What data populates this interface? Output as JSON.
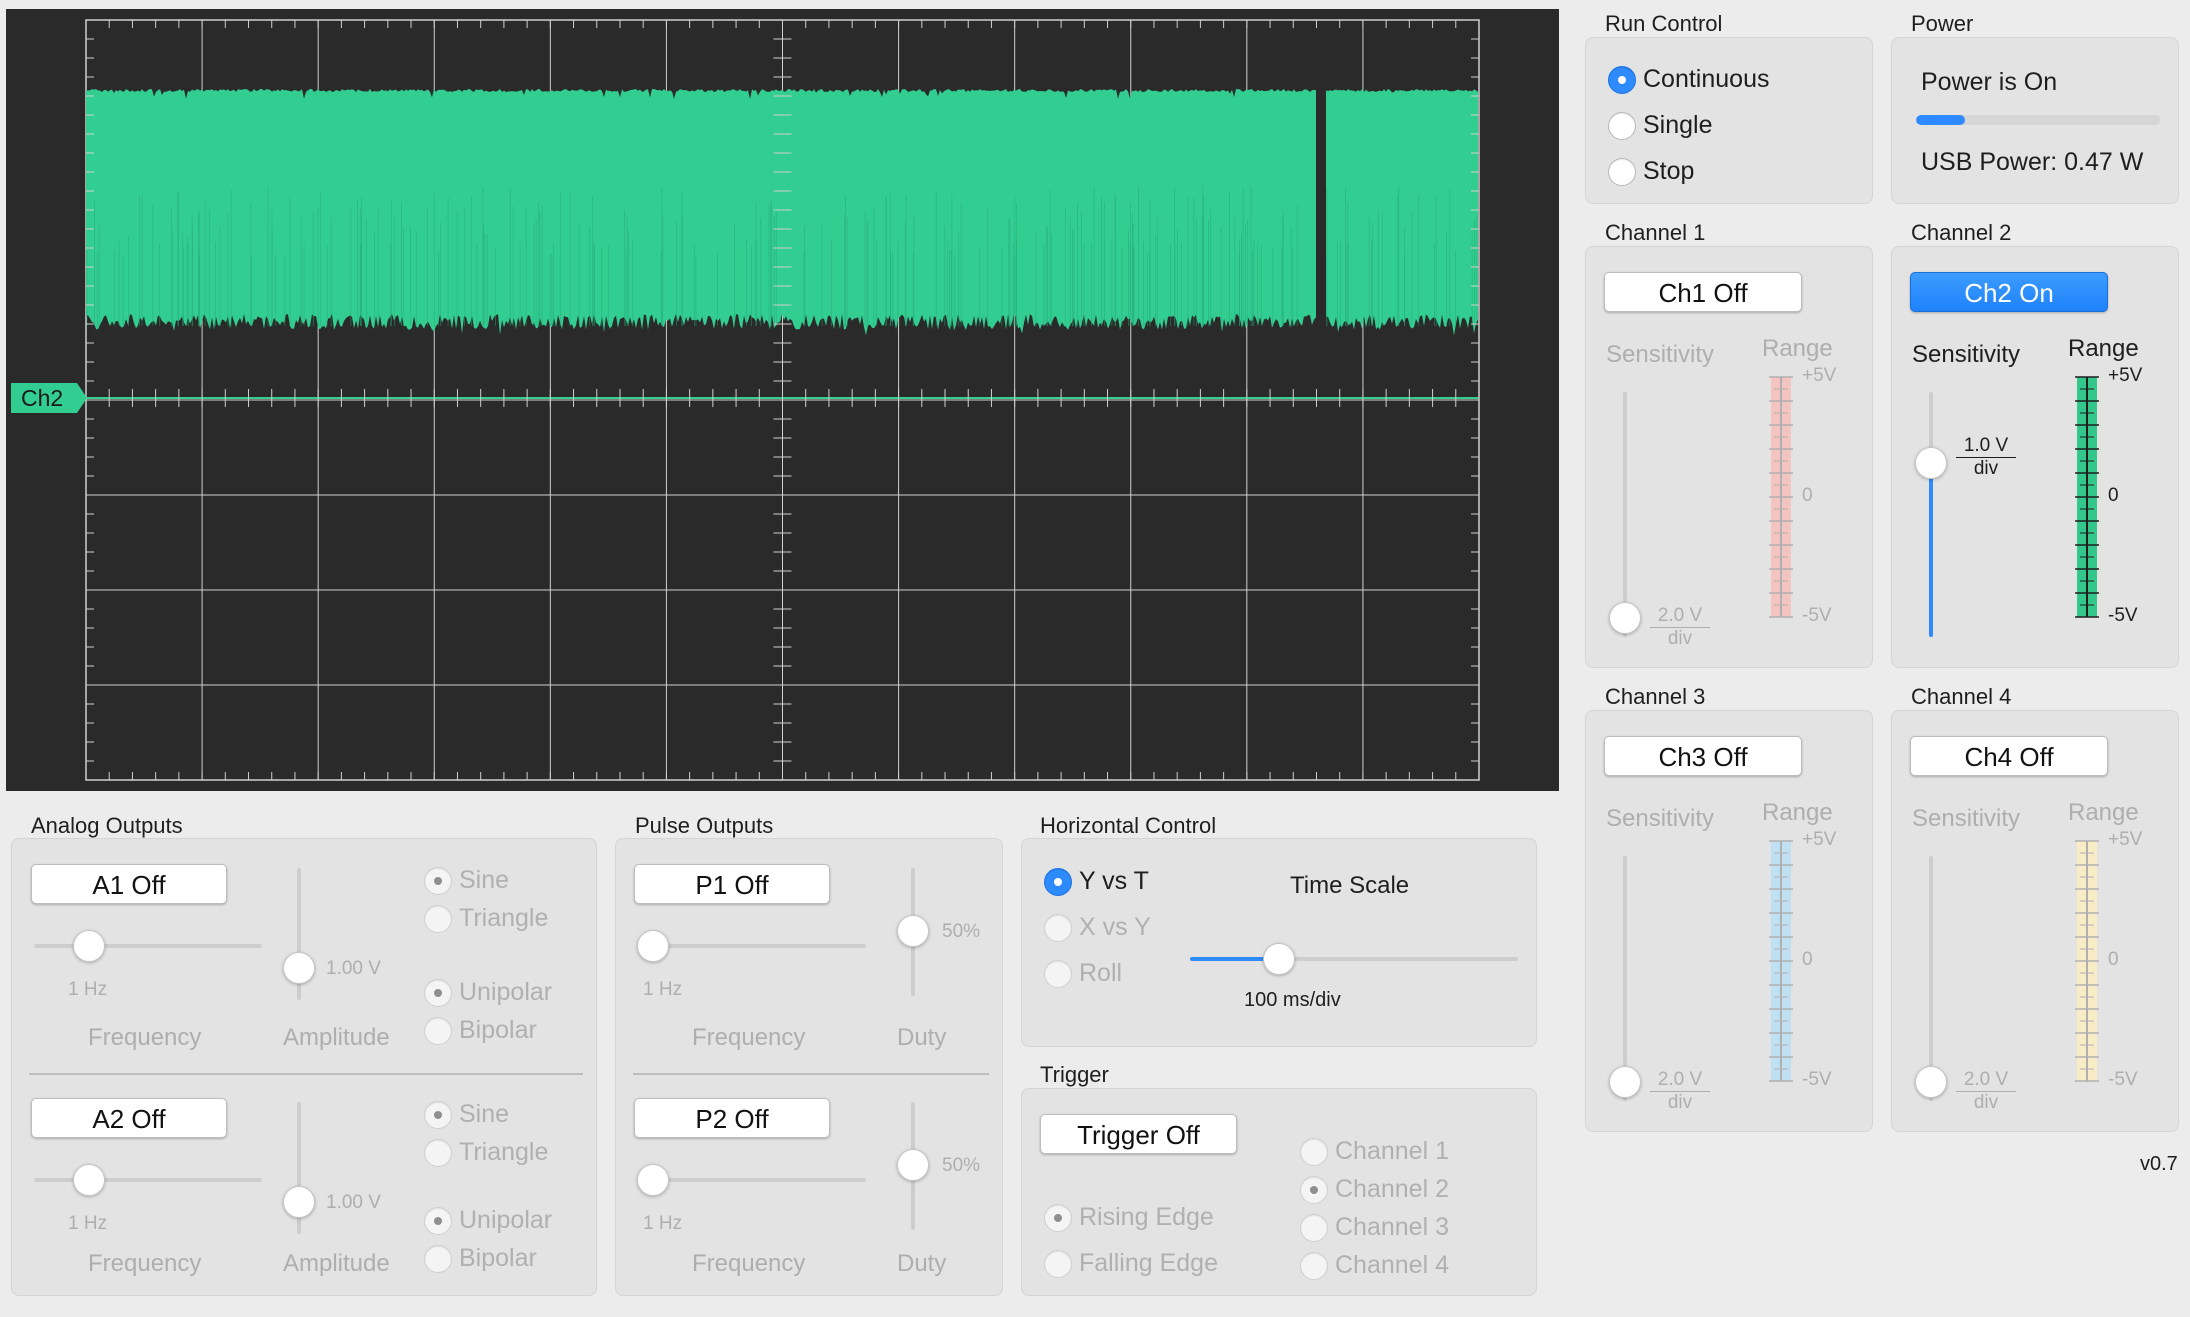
{
  "scope": {
    "channel_marker": "Ch2",
    "trace_color": "#32cd91",
    "background": "#2a2a2a",
    "grid_color": "#d0d0d0"
  },
  "run_control": {
    "title": "Run Control",
    "options": [
      "Continuous",
      "Single",
      "Stop"
    ],
    "selected": "Continuous"
  },
  "power": {
    "title": "Power",
    "status": "Power is On",
    "usb_power": "USB Power: 0.47 W",
    "level": 0.2
  },
  "channels": [
    {
      "title": "Channel 1",
      "button": "Ch1 Off",
      "on": false,
      "sensitivity_label": "Sensitivity",
      "range_label": "Range",
      "sens_value": "2.0 V",
      "sens_unit": "div",
      "top": "+5V",
      "mid": "0",
      "bottom": "-5V",
      "color": "#f4c4c0"
    },
    {
      "title": "Channel 2",
      "button": "Ch2 On",
      "on": true,
      "sensitivity_label": "Sensitivity",
      "range_label": "Range",
      "sens_value": "1.0 V",
      "sens_unit": "div",
      "top": "+5V",
      "mid": "0",
      "bottom": "-5V",
      "color": "#33c78c"
    },
    {
      "title": "Channel 3",
      "button": "Ch3 Off",
      "on": false,
      "sensitivity_label": "Sensitivity",
      "range_label": "Range",
      "sens_value": "2.0 V",
      "sens_unit": "div",
      "top": "+5V",
      "mid": "0",
      "bottom": "-5V",
      "color": "#bfe0f2"
    },
    {
      "title": "Channel 4",
      "button": "Ch4 Off",
      "on": false,
      "sensitivity_label": "Sensitivity",
      "range_label": "Range",
      "sens_value": "2.0 V",
      "sens_unit": "div",
      "top": "+5V",
      "mid": "0",
      "bottom": "-5V",
      "color": "#f7ecc6"
    }
  ],
  "analog": {
    "title": "Analog Outputs",
    "outputs": [
      {
        "button": "A1 Off",
        "freq_value": "1 Hz",
        "freq_label": "Frequency",
        "amp_value": "1.00 V",
        "amp_label": "Amplitude",
        "wave": [
          "Sine",
          "Triangle"
        ],
        "polarity": [
          "Unipolar",
          "Bipolar"
        ]
      },
      {
        "button": "A2 Off",
        "freq_value": "1 Hz",
        "freq_label": "Frequency",
        "amp_value": "1.00 V",
        "amp_label": "Amplitude",
        "wave": [
          "Sine",
          "Triangle"
        ],
        "polarity": [
          "Unipolar",
          "Bipolar"
        ]
      }
    ]
  },
  "pulse": {
    "title": "Pulse Outputs",
    "outputs": [
      {
        "button": "P1 Off",
        "freq_value": "1 Hz",
        "freq_label": "Frequency",
        "duty_value": "50%",
        "duty_label": "Duty"
      },
      {
        "button": "P2 Off",
        "freq_value": "1 Hz",
        "freq_label": "Frequency",
        "duty_value": "50%",
        "duty_label": "Duty"
      }
    ]
  },
  "horizontal": {
    "title": "Horizontal Control",
    "modes": [
      "Y vs T",
      "X vs Y",
      "Roll"
    ],
    "selected": "Y vs T",
    "time_scale_label": "Time Scale",
    "time_scale_value": "100 ms/div",
    "time_scale_level": 0.27
  },
  "trigger": {
    "title": "Trigger",
    "button": "Trigger Off",
    "edges": [
      "Rising Edge",
      "Falling Edge"
    ],
    "channels": [
      "Channel 1",
      "Channel 2",
      "Channel 3",
      "Channel 4"
    ]
  },
  "version": "v0.7"
}
